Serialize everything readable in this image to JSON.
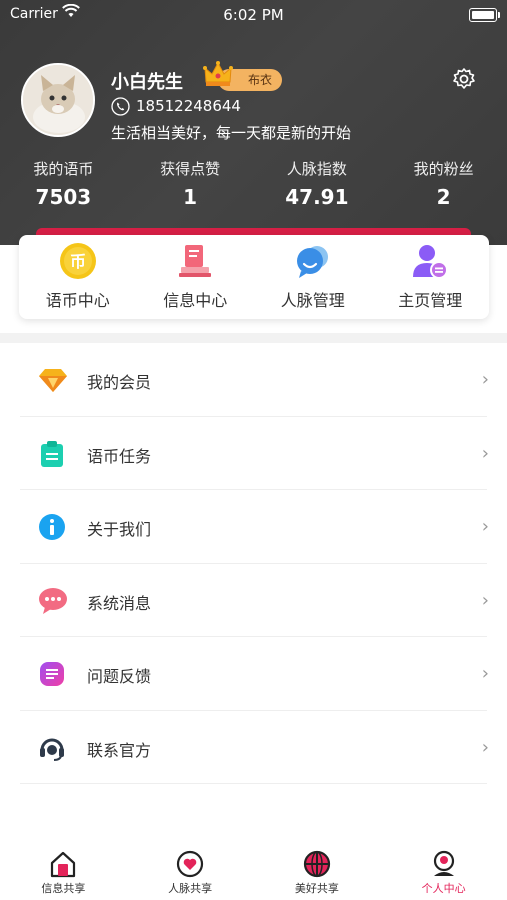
{
  "status_bar": {
    "carrier": "Carrier",
    "time": "6:02 PM"
  },
  "profile": {
    "name": "小白先生",
    "level": "布衣",
    "phone": "18512248644",
    "motto": "生活相当美好，每一天都是新的开始"
  },
  "stats": [
    {
      "label": "我的语币",
      "value": "7503"
    },
    {
      "label": "获得点赞",
      "value": "1"
    },
    {
      "label": "人脉指数",
      "value": "47.91"
    },
    {
      "label": "我的粉丝",
      "value": "2"
    }
  ],
  "quick_actions": [
    {
      "label": "语币中心",
      "icon": "coin-icon"
    },
    {
      "label": "信息中心",
      "icon": "info-stamp-icon"
    },
    {
      "label": "人脉管理",
      "icon": "contacts-icon"
    },
    {
      "label": "主页管理",
      "icon": "profile-manage-icon"
    }
  ],
  "menu": [
    {
      "label": "我的会员",
      "icon": "diamond-icon"
    },
    {
      "label": "语币任务",
      "icon": "clipboard-icon"
    },
    {
      "label": "关于我们",
      "icon": "info-icon"
    },
    {
      "label": "系统消息",
      "icon": "chat-bubble-icon"
    },
    {
      "label": "问题反馈",
      "icon": "feedback-icon"
    },
    {
      "label": "联系官方",
      "icon": "headset-icon"
    }
  ],
  "tabs": [
    {
      "label": "信息共享",
      "icon": "home-icon",
      "active": false
    },
    {
      "label": "人脉共享",
      "icon": "heart-icon",
      "active": false
    },
    {
      "label": "美好共享",
      "icon": "globe-icon",
      "active": false
    },
    {
      "label": "个人中心",
      "icon": "person-icon",
      "active": true
    }
  ],
  "colors": {
    "header_bg": "#3f3f3f",
    "accent": "#e3245a",
    "badge": "#f3b361",
    "coin": "#f5c518",
    "contacts": "#3a8ee6",
    "profile_manage": "#8b5cf6"
  }
}
